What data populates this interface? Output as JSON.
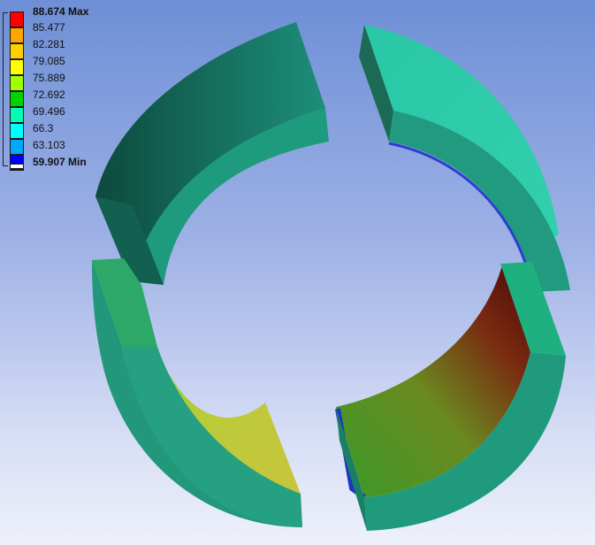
{
  "legend": {
    "max_label": "88.674 Max",
    "min_label": "59.907 Min",
    "intermediate": [
      "85.477",
      "82.281",
      "79.085",
      "75.889",
      "72.692",
      "69.496",
      "66.3",
      "63.103"
    ],
    "colors": [
      "#ff0000",
      "#ffa500",
      "#ffd000",
      "#ffff00",
      "#a0ff00",
      "#00d400",
      "#00ffb2",
      "#00ffff",
      "#00a8ff",
      "#0000ff",
      "#ffffff"
    ]
  },
  "model": {
    "segments": [
      "upper-left-pad",
      "upper-right-pad",
      "lower-left-pad",
      "lower-right-pad"
    ],
    "base_color": "#1f9e7c",
    "inner_gradient_warm": [
      "#5a0a0a",
      "#c8d040",
      "#2e9a30"
    ]
  }
}
